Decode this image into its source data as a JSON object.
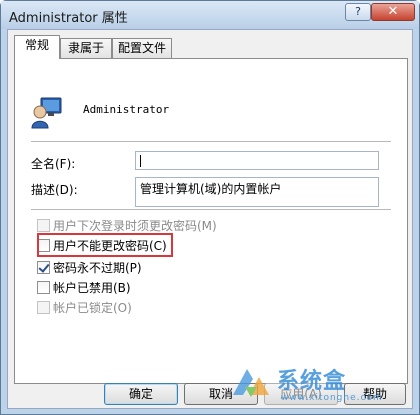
{
  "window": {
    "title": "Administrator 属性",
    "help_glyph": "?",
    "close_glyph": "✕"
  },
  "tabs": [
    {
      "label": "常规",
      "active": true
    },
    {
      "label": "隶属于",
      "active": false
    },
    {
      "label": "配置文件",
      "active": false
    }
  ],
  "user": {
    "name": "Administrator",
    "icon": "user-icon"
  },
  "form": {
    "fullname_label": "全名(F):",
    "fullname_value": "",
    "description_label": "描述(D):",
    "description_value": "管理计算机(域)的内置帐户"
  },
  "options": [
    {
      "label": "用户下次登录时须更改密码(M)",
      "checked": false,
      "disabled": true
    },
    {
      "label": "用户不能更改密码(C)",
      "checked": false,
      "disabled": false,
      "highlighted": true
    },
    {
      "label": "密码永不过期(P)",
      "checked": true,
      "disabled": false
    },
    {
      "label": "帐户已禁用(B)",
      "checked": false,
      "disabled": false
    },
    {
      "label": "帐户已锁定(O)",
      "checked": false,
      "disabled": true
    }
  ],
  "buttons": {
    "ok": "确定",
    "cancel": "取消",
    "apply": "应用(A)",
    "help": "帮助"
  },
  "watermark": {
    "name": "系统盒",
    "url": "www.xitonghe.com"
  },
  "colors": {
    "highlight_border": "#d9373b",
    "accent": "#3a8fd8"
  }
}
